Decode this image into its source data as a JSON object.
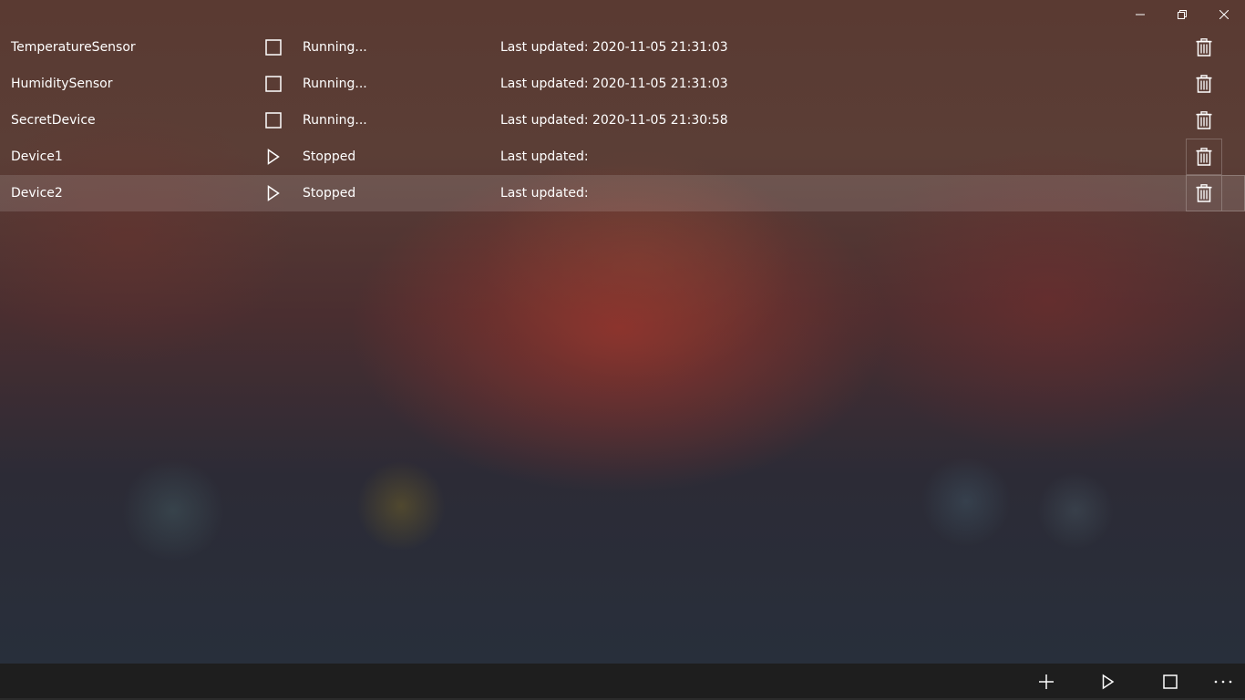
{
  "window": {
    "controls": [
      {
        "name": "minimize",
        "icon": "minimize-icon"
      },
      {
        "name": "restore",
        "icon": "restore-icon"
      },
      {
        "name": "close",
        "icon": "close-icon"
      }
    ]
  },
  "devices": [
    {
      "name": "TemperatureSensor",
      "state_icon": "stop-icon",
      "status": "Running...",
      "updated": "Last updated: 2020-11-05 21:31:03"
    },
    {
      "name": "HumiditySensor",
      "state_icon": "stop-icon",
      "status": "Running...",
      "updated": "Last updated: 2020-11-05 21:31:03"
    },
    {
      "name": "SecretDevice",
      "state_icon": "stop-icon",
      "status": "Running...",
      "updated": "Last updated: 2020-11-05 21:30:58"
    },
    {
      "name": "Device1",
      "state_icon": "play-icon",
      "status": "Stopped",
      "updated": "Last updated:"
    },
    {
      "name": "Device2",
      "state_icon": "play-icon",
      "status": "Stopped",
      "updated": "Last updated:"
    }
  ],
  "selected_device_index": 4,
  "command_bar": {
    "buttons": [
      {
        "name": "add",
        "icon": "plus-icon"
      },
      {
        "name": "start-all",
        "icon": "play-icon"
      },
      {
        "name": "stop-all",
        "icon": "stop-icon"
      },
      {
        "name": "more",
        "icon": "more-icon"
      }
    ]
  },
  "colors": {
    "foreground": "#ffffff",
    "command_bar_bg": "#1e1e1e",
    "selection": "rgba(255,255,255,0.13)"
  }
}
